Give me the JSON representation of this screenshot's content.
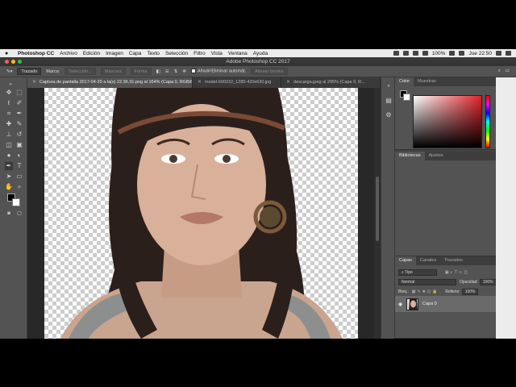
{
  "menubar": {
    "apple": "",
    "app_name": "Photoshop CC",
    "items": [
      "Archivo",
      "Edición",
      "Imagen",
      "Capa",
      "Texto",
      "Selección",
      "Filtro",
      "Vista",
      "Ventana",
      "Ayuda"
    ],
    "battery": "100%",
    "clock": "Jue 22:50"
  },
  "window": {
    "title": "Adobe Photoshop CC 2017"
  },
  "options": {
    "mode": "Trazado",
    "mark_label": "Marca:",
    "selection_btn": "Selección...",
    "mask_btn": "Máscara",
    "shape_btn": "Forma",
    "auto_add_label": "Añadir/Eliminar automát.",
    "align_edges_label": "Alinear bordes"
  },
  "tabs": [
    {
      "label": "Captura de pantalla 2017-04-20 a la(s) 22.36.31.png al 164% (Capa 0, RGB/8*) *",
      "active": true
    },
    {
      "label": "model-600222_1280-420x630.jpg",
      "active": false
    },
    {
      "label": "descarga.jpeg al 295% (Capa 0, R...",
      "active": false
    }
  ],
  "color_panel": {
    "tabs": [
      "Color",
      "Muestras"
    ],
    "active_tab": "Color",
    "fg_color": "#000000",
    "bg_color": "#ffffff",
    "selected_hue": "#e3242b"
  },
  "libraries_panel": {
    "tabs": [
      "Bibliotecas",
      "Ajustes"
    ],
    "active_tab": "Bibliotecas"
  },
  "layers_panel": {
    "tabs": [
      "Capas",
      "Canales",
      "Trazados"
    ],
    "active_tab": "Capas",
    "filter": "Tipo",
    "blend_mode": "Normal",
    "opacity_label": "Opacidad:",
    "opacity_value": "100%",
    "lock_label": "Bloq.:",
    "fill_label": "Relleno:",
    "fill_value": "100%",
    "layers": [
      {
        "name": "Capa 0",
        "visible": true
      }
    ]
  }
}
